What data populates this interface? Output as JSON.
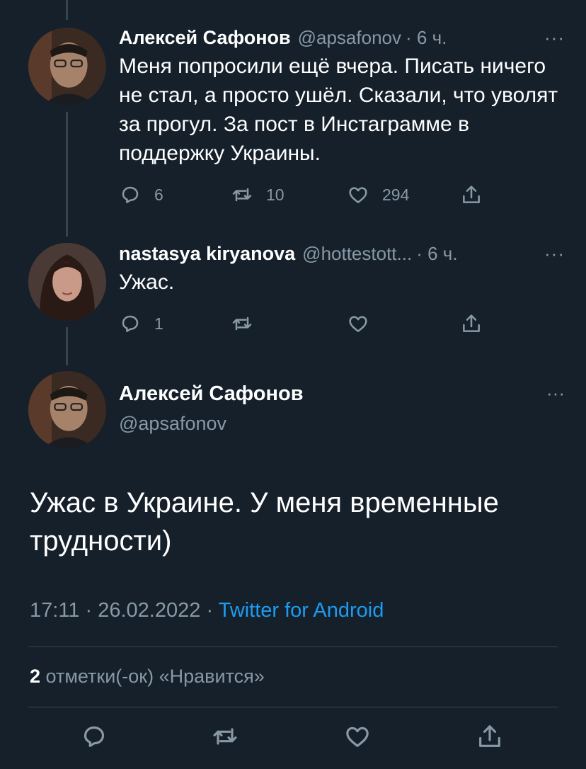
{
  "tweets": [
    {
      "name": "Алексей Сафонов",
      "handle": "@apsafonov",
      "time": "· 6 ч.",
      "text": "Меня попросили ещё вчера. Писать ничего не стал, а просто ушёл. Сказали, что уволят за прогул. За пост в Инстаграмме в поддержку Украины.",
      "replies": "6",
      "retweets": "10",
      "likes": "294"
    },
    {
      "name": "nastasya kiryanova",
      "handle": "@hottestott...",
      "time": "· 6 ч.",
      "text": "Ужас.",
      "replies": "1",
      "retweets": "",
      "likes": ""
    }
  ],
  "main_tweet": {
    "name": "Алексей Сафонов",
    "handle": "@apsafonov",
    "text": "Ужас в Украине. У меня временные трудности)",
    "time": "17:11",
    "date": "26.02.2022",
    "source": "Twitter for Android",
    "likes_count": "2",
    "likes_label": "отметки(-ок) «Нравится»"
  },
  "more_label": "···",
  "separator": "·",
  "icons": [
    "reply-icon",
    "retweet-icon",
    "like-icon",
    "share-icon",
    "more-icon"
  ],
  "colors": {
    "background": "#15202b",
    "secondary_text": "#8899a6",
    "link": "#1d9bf0",
    "divider": "#38444d"
  }
}
